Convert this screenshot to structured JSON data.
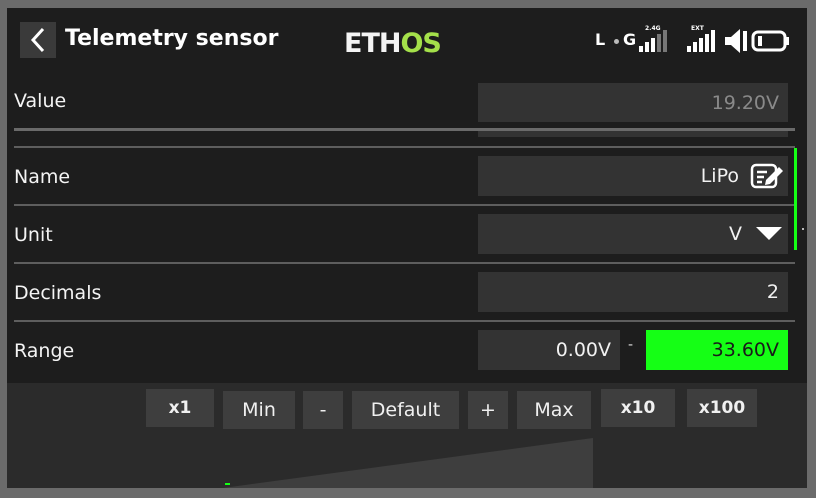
{
  "header": {
    "title": "Telemetry sensor",
    "logo_part1": "ETH",
    "logo_part2": "OS",
    "status": {
      "l_label": "L",
      "g_label": "G",
      "band_label": "2.4G",
      "ext_label": "EXT"
    }
  },
  "rows": {
    "value": {
      "label": "Value",
      "value": "19.20V"
    },
    "name": {
      "label": "Name",
      "value": "LiPo"
    },
    "unit": {
      "label": "Unit",
      "value": "V"
    },
    "decimals": {
      "label": "Decimals",
      "value": "2"
    },
    "range": {
      "label": "Range",
      "min": "0.00V",
      "separator": "-",
      "max": "33.60V"
    }
  },
  "toolbar": {
    "x1": "x1",
    "min": "Min",
    "minus": "-",
    "default": "Default",
    "plus": "+",
    "max": "Max",
    "x10": "x10",
    "x100": "x100"
  },
  "colors": {
    "accent_green": "#15ff15",
    "logo_green": "#a4e04a",
    "field_bg": "#333333",
    "screen_bg": "#1d1d1d"
  },
  "icons": [
    "back-arrow-icon",
    "edit-icon",
    "dropdown-arrow-icon",
    "signal-bars-icon",
    "speaker-icon",
    "battery-icon"
  ]
}
